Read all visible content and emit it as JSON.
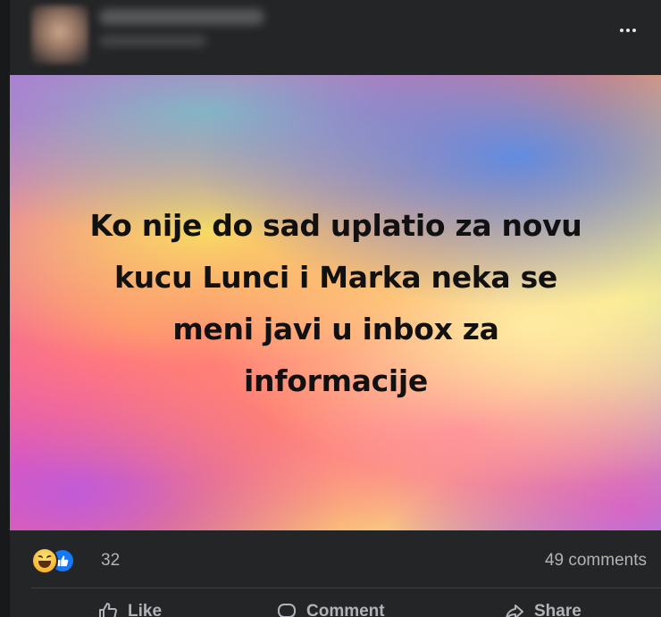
{
  "post": {
    "more_icon": "more-horizontal-icon",
    "text_lines": [
      "Ko nije do sad uplatio za novu",
      "kucu Lunci i Marka neka se",
      "meni javi u inbox za",
      "informacije"
    ],
    "background_colors": {
      "blue": "#5a8ce6",
      "yellow": "#f8e260",
      "orange": "#ff8a6e",
      "pink": "#ff6e96",
      "purple": "#be5adc"
    },
    "text_color": "#111111"
  },
  "reactions": {
    "icons": [
      "haha-reaction-icon",
      "like-reaction-icon"
    ],
    "count": "32",
    "comments": "49 comments"
  },
  "actions": {
    "like_label": "Like",
    "comment_label": "Comment",
    "share_label": "Share"
  },
  "theme": {
    "page_background": "#18191a",
    "card_background": "#242526",
    "secondary_text": "#b0b3b8",
    "like_blue": "#1877f2"
  }
}
